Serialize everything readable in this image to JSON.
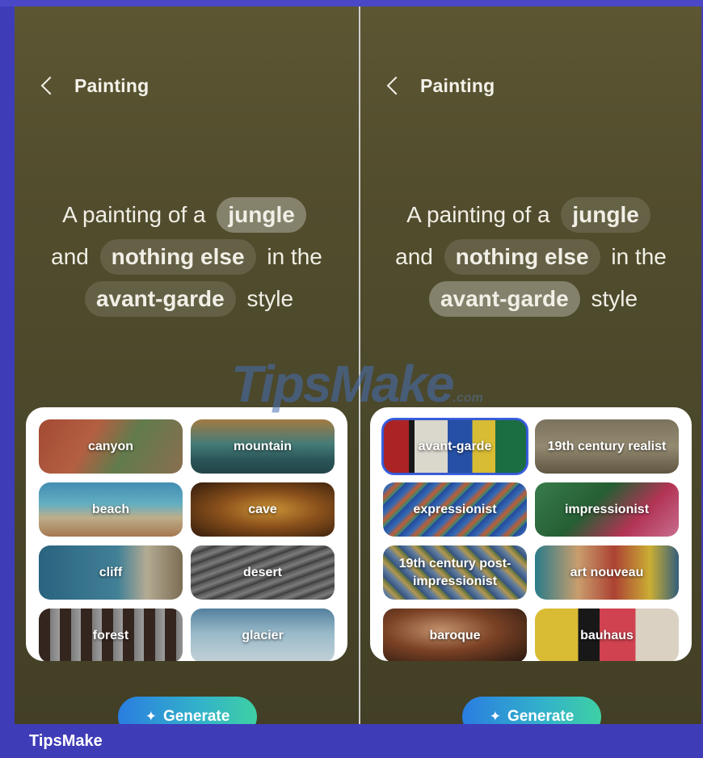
{
  "left_screen": {
    "header_title": "Painting",
    "prompt": {
      "prefix": "A painting of a",
      "subject": "jungle",
      "and_word": "and",
      "modifier": "nothing else",
      "in_the": "in the",
      "style_value": "avant-garde",
      "style_word": "style"
    },
    "options": [
      "canyon",
      "mountain",
      "beach",
      "cave",
      "cliff",
      "desert",
      "forest",
      "glacier"
    ],
    "generate_label": "Generate"
  },
  "right_screen": {
    "header_title": "Painting",
    "prompt": {
      "prefix": "A painting of a",
      "subject": "jungle",
      "and_word": "and",
      "modifier": "nothing else",
      "in_the": "in the",
      "style_value": "avant-garde",
      "style_word": "style"
    },
    "options": [
      "avant-garde",
      "19th century realist",
      "expressionist",
      "impressionist",
      "19th century post-impressionist",
      "art nouveau",
      "baroque",
      "bauhaus"
    ],
    "selected_option": "avant-garde",
    "generate_label": "Generate"
  },
  "watermark": {
    "main": "TipsMake",
    "suffix": ".com"
  },
  "footer": {
    "brand": "TipsMake"
  },
  "colors": {
    "frame": "#3f3cb8",
    "selected_outline": "#3a5fe0",
    "generate_start": "#2a7de0",
    "generate_end": "#3fd0a4"
  },
  "icons": {
    "back": "chevron-left-icon",
    "generate": "sparkle-icon"
  }
}
